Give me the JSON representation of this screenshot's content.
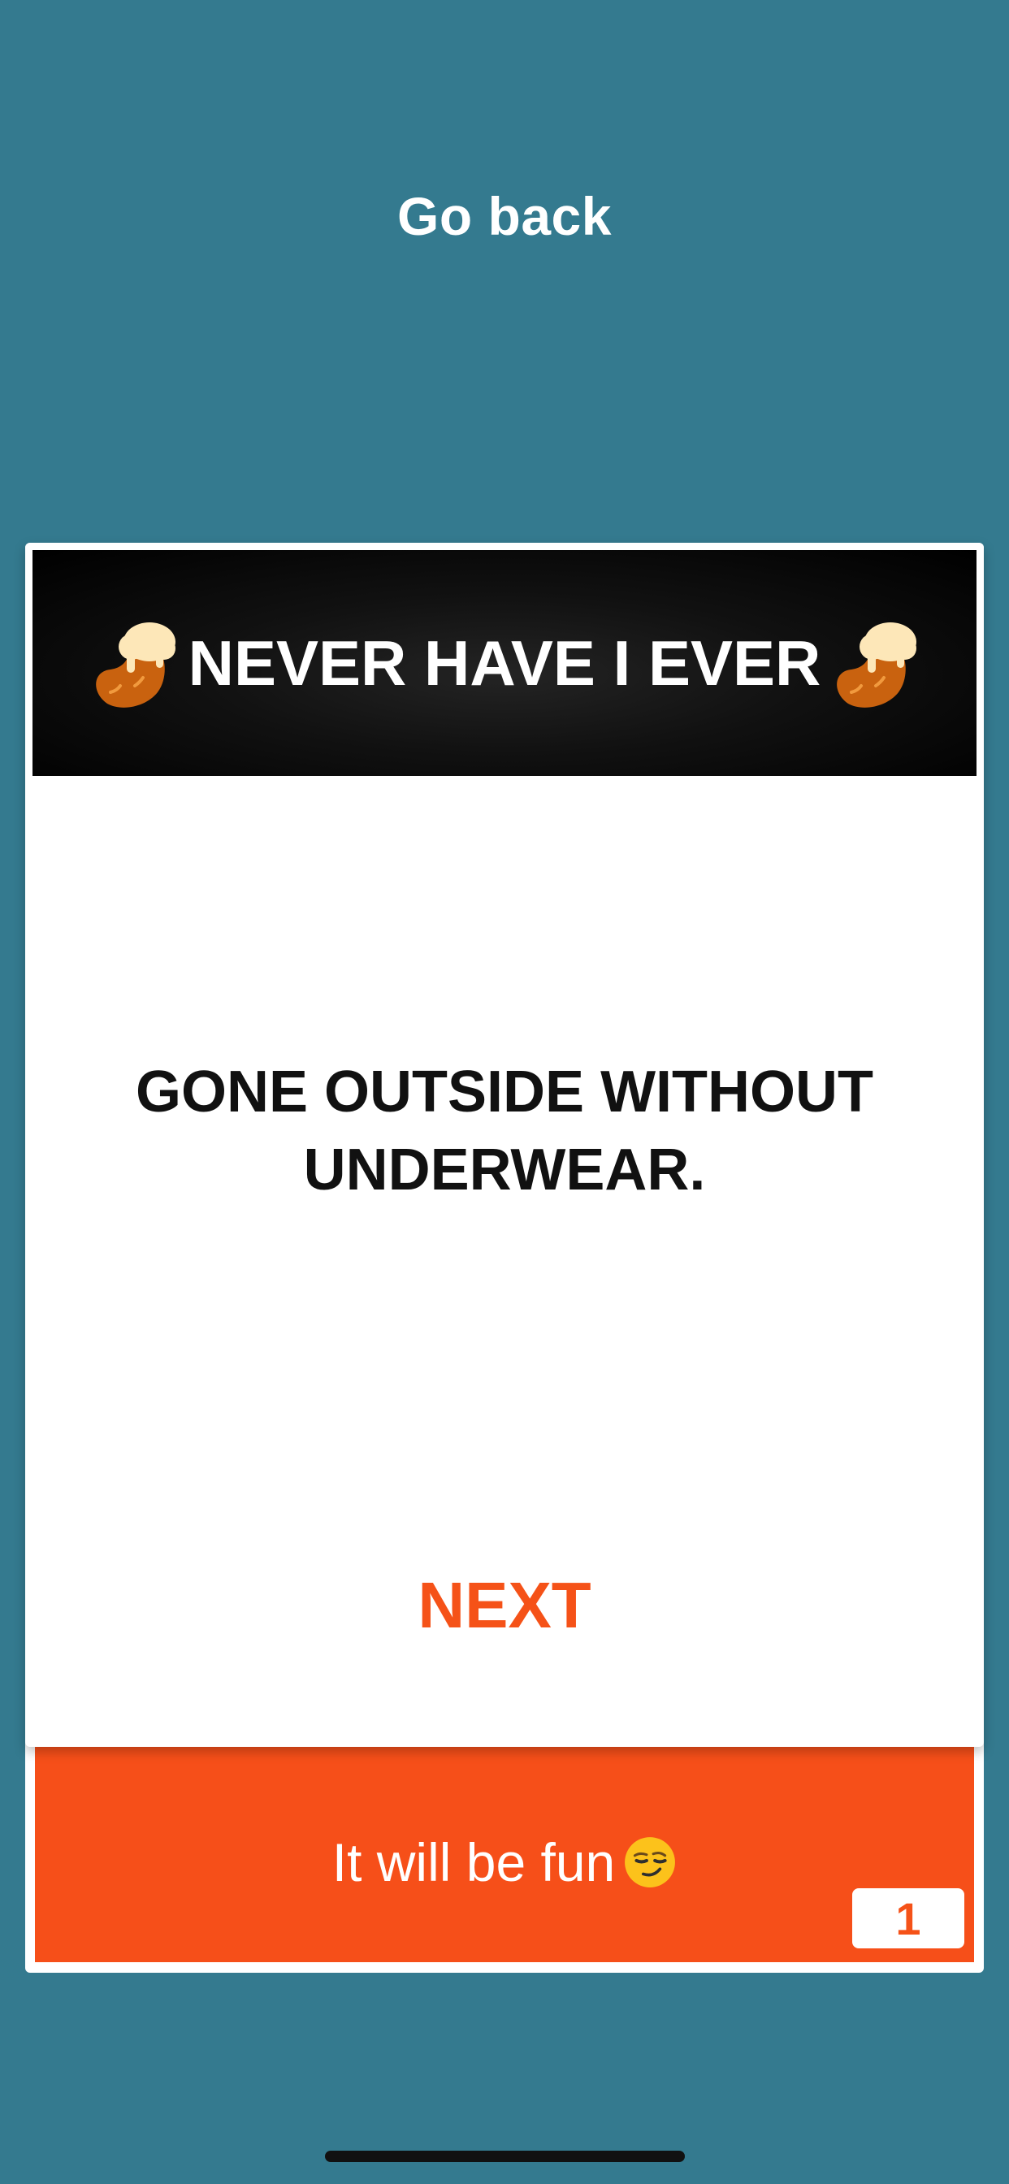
{
  "nav": {
    "back_label": "Go back"
  },
  "card": {
    "title": "NEVER HAVE I EVER",
    "title_icon": "beer-mug-icon",
    "question": "GONE OUTSIDE WITHOUT UNDERWEAR.",
    "next_label": "NEXT"
  },
  "footer": {
    "message": "It will be fun",
    "message_icon": "smirking-face-icon",
    "counter": "1"
  },
  "colors": {
    "background": "#347a8f",
    "accent": "#f64f19",
    "header": "#000000",
    "card": "#ffffff"
  }
}
